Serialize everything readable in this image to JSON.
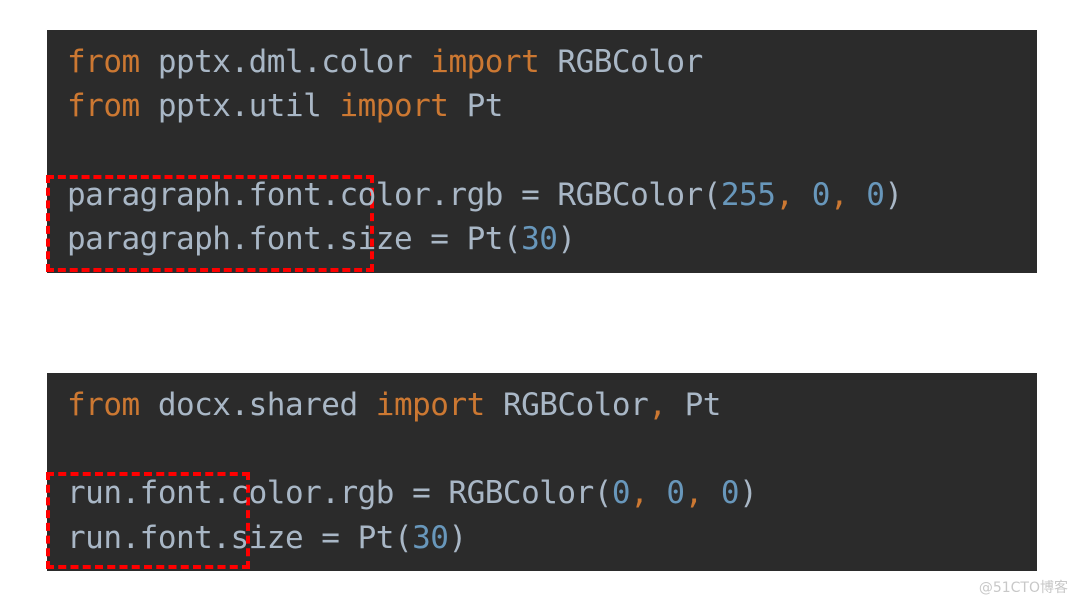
{
  "panels": [
    {
      "lines": [
        [
          {
            "t": "from",
            "c": "kw"
          },
          {
            "t": " pptx.dml.color ",
            "c": ""
          },
          {
            "t": "import",
            "c": "kw"
          },
          {
            "t": " RGBColor",
            "c": ""
          }
        ],
        [
          {
            "t": "from",
            "c": "kw"
          },
          {
            "t": " pptx.util ",
            "c": ""
          },
          {
            "t": "import",
            "c": "kw"
          },
          {
            "t": " Pt",
            "c": ""
          }
        ],
        [],
        [
          {
            "t": "paragraph.font.color.rgb = RGBColor(",
            "c": ""
          },
          {
            "t": "255",
            "c": "num"
          },
          {
            "t": ", ",
            "c": "punc"
          },
          {
            "t": "0",
            "c": "num"
          },
          {
            "t": ", ",
            "c": "punc"
          },
          {
            "t": "0",
            "c": "num"
          },
          {
            "t": ")",
            "c": ""
          }
        ],
        [
          {
            "t": "paragraph.font.size = Pt(",
            "c": ""
          },
          {
            "t": "30",
            "c": "num"
          },
          {
            "t": ")",
            "c": ""
          }
        ]
      ],
      "highlight": "paragraph.font."
    },
    {
      "lines": [
        [
          {
            "t": "from",
            "c": "kw"
          },
          {
            "t": " docx.shared ",
            "c": ""
          },
          {
            "t": "import",
            "c": "kw"
          },
          {
            "t": " RGBColor",
            "c": ""
          },
          {
            "t": ",",
            "c": "punc"
          },
          {
            "t": " Pt",
            "c": ""
          }
        ],
        [],
        [
          {
            "t": "run.font.color.rgb = RGBColor(",
            "c": ""
          },
          {
            "t": "0",
            "c": "num"
          },
          {
            "t": ", ",
            "c": "punc"
          },
          {
            "t": "0",
            "c": "num"
          },
          {
            "t": ", ",
            "c": "punc"
          },
          {
            "t": "0",
            "c": "num"
          },
          {
            "t": ")",
            "c": ""
          }
        ],
        [
          {
            "t": "run.font.size = Pt(",
            "c": ""
          },
          {
            "t": "30",
            "c": "num"
          },
          {
            "t": ")",
            "c": ""
          }
        ]
      ],
      "highlight": "run.font."
    }
  ],
  "watermark": "@51CTO博客",
  "colors": {
    "background": "#2b2b2b",
    "keyword": "#cc7832",
    "number": "#6897bb",
    "text": "#a9b7c6",
    "highlight_box": "#ff0000"
  }
}
